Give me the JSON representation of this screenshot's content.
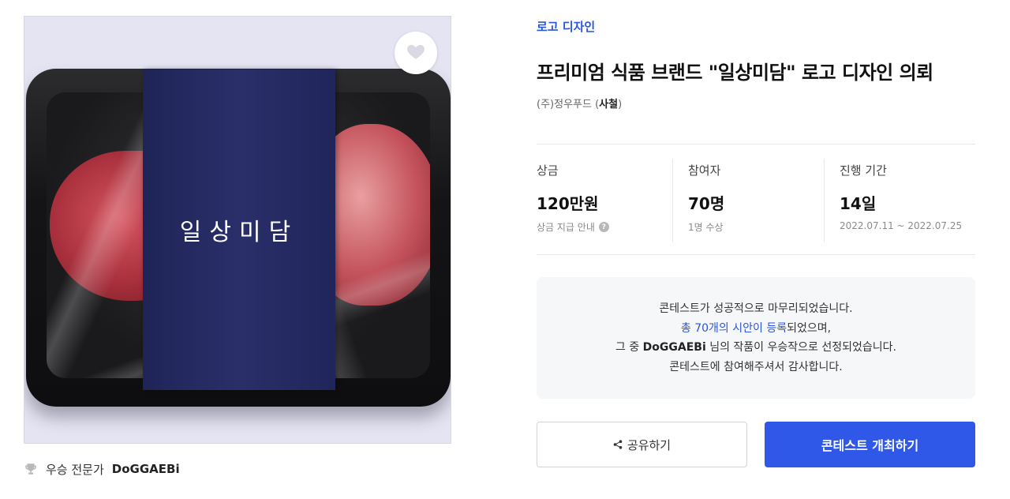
{
  "image": {
    "band_logo_text": "일상미담",
    "favorite_icon": "heart-icon"
  },
  "winner": {
    "icon": "trophy-icon",
    "prefix": "우승 전문가",
    "name": "DoGGAEBi"
  },
  "contest": {
    "category": "로고 디자인",
    "title": "프리미엄 식품 브랜드 \"일상미담\" 로고 디자인 의뢰",
    "company": "(주)정우푸드",
    "company_badge": "사철"
  },
  "stats": {
    "prize": {
      "label": "상금",
      "value": "120만원",
      "sub": "상금 지급 안내"
    },
    "participants": {
      "label": "참여자",
      "value": "70명",
      "sub": "1명 수상"
    },
    "period": {
      "label": "진행 기간",
      "value": "14일",
      "sub": "2022.07.11 ~ 2022.07.25"
    }
  },
  "notice": {
    "line1": "콘테스트가 성공적으로 마무리되었습니다.",
    "line2_link": "총 70개의 시안이 등록",
    "line2_rest": "되었으며,",
    "line3_pre": "그 중 ",
    "line3_name": "DoGGAEBi",
    "line3_post": " 님의 작품이 우승작으로 선정되었습니다.",
    "line4": "콘테스트에 참여해주셔서 감사합니다."
  },
  "actions": {
    "share_label": "공유하기",
    "host_label": "콘테스트 개최하기"
  },
  "colors": {
    "accent": "#2f58e8",
    "link": "#2b56d6",
    "band": "#262b63"
  }
}
